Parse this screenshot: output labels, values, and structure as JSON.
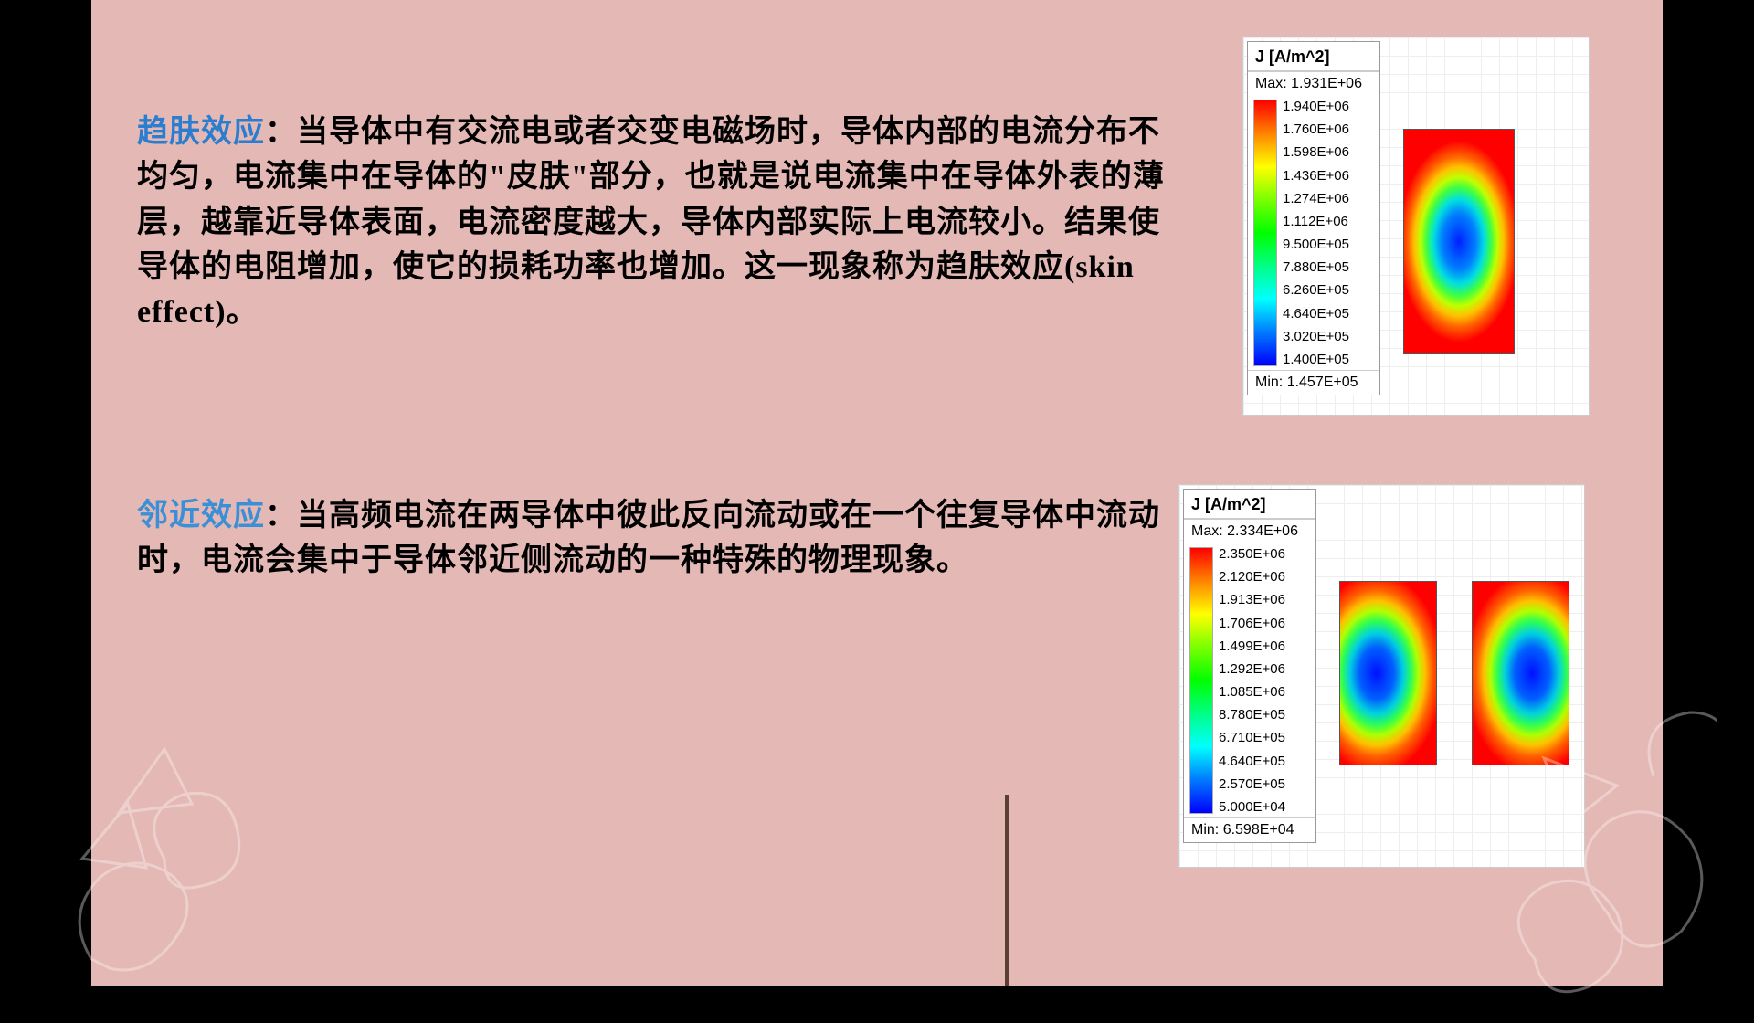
{
  "section1": {
    "term": "趋肤效应",
    "text": "：当导体中有交流电或者交变电磁场时，导体内部的电流分布不均匀，电流集中在导体的\"皮肤\"部分，也就是说电流集中在导体外表的薄层，越靠近导体表面，电流密度越大，导体内部实际上电流较小。结果使导体的电阻增加，使它的损耗功率也增加。这一现象称为趋肤效应(skin effect)。"
  },
  "section2": {
    "term": "邻近效应",
    "text": "：当高频电流在两导体中彼此反向流动或在一个往复导体中流动时，电流会集中于导体邻近侧流动的一种特殊的物理现象。"
  },
  "legend1": {
    "title": "J [A/m^2]",
    "max_label": "Max:",
    "max_value": "1.931E+06",
    "min_label": "Min:",
    "min_value": "1.457E+05",
    "values": [
      "1.940E+06",
      "1.760E+06",
      "1.598E+06",
      "1.436E+06",
      "1.274E+06",
      "1.112E+06",
      "9.500E+05",
      "7.880E+05",
      "6.260E+05",
      "4.640E+05",
      "3.020E+05",
      "1.400E+05"
    ]
  },
  "legend2": {
    "title": "J [A/m^2]",
    "max_label": "Max:",
    "max_value": "2.334E+06",
    "min_label": "Min:",
    "min_value": "6.598E+04",
    "values": [
      "2.350E+06",
      "2.120E+06",
      "1.913E+06",
      "1.706E+06",
      "1.499E+06",
      "1.292E+06",
      "1.085E+06",
      "8.780E+05",
      "6.710E+05",
      "4.640E+05",
      "2.570E+05",
      "5.000E+04"
    ]
  }
}
